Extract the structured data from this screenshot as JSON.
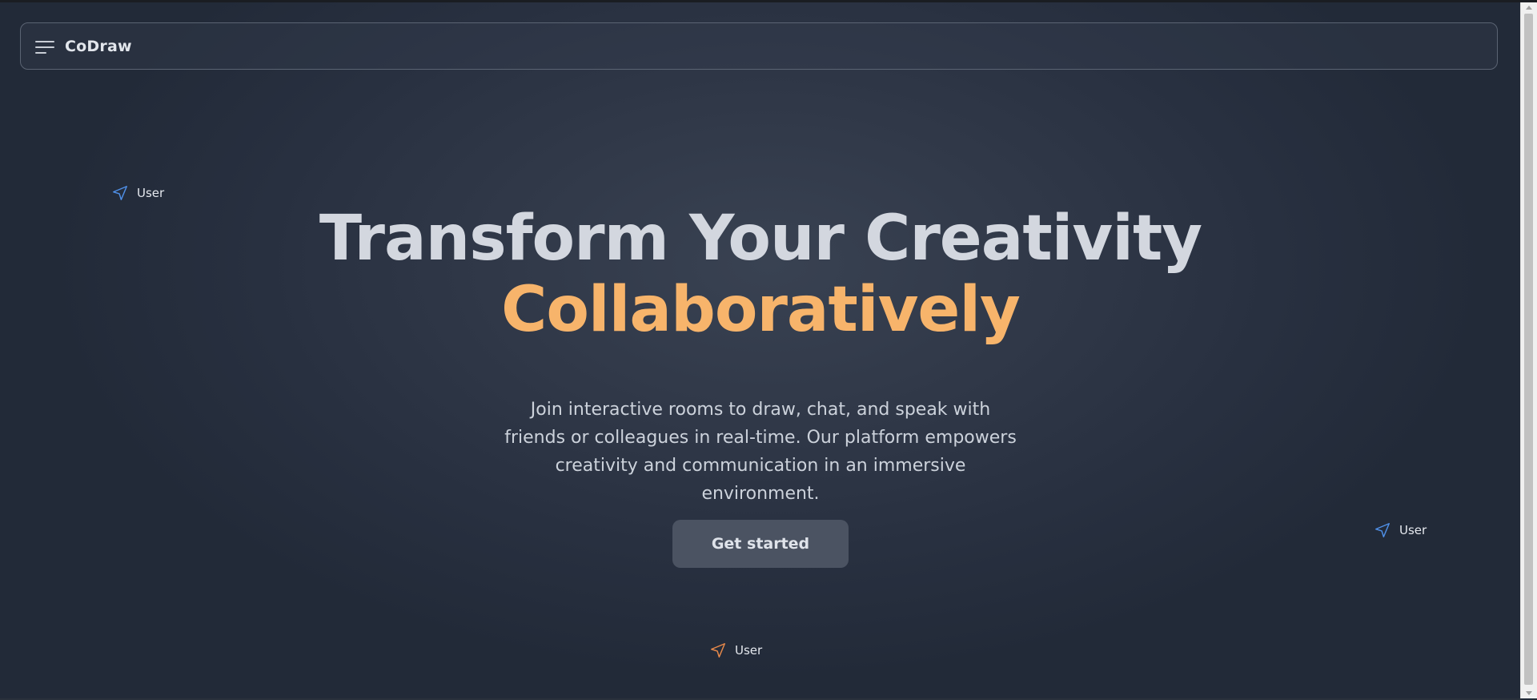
{
  "navbar": {
    "brand": "CoDraw",
    "menu_icon": "menu-icon"
  },
  "cursors": [
    {
      "label": "User",
      "icon": "send-arrow-icon",
      "color": "#4f8fe6"
    },
    {
      "label": "User",
      "icon": "send-arrow-icon",
      "color": "#4f8fe6"
    },
    {
      "label": "User",
      "icon": "send-arrow-icon",
      "color": "#e8894a"
    }
  ],
  "hero": {
    "title_line1": "Transform Your Creativity",
    "title_line2": "Collaboratively",
    "subtitle": "Join interactive rooms to draw, chat, and speak with friends or colleagues in real-time. Our platform empowers creativity and communication in an immersive environment.",
    "cta_label": "Get started"
  },
  "colors": {
    "accent": "#f7b46b",
    "title": "#d3d7df",
    "background": "#2b3342"
  }
}
